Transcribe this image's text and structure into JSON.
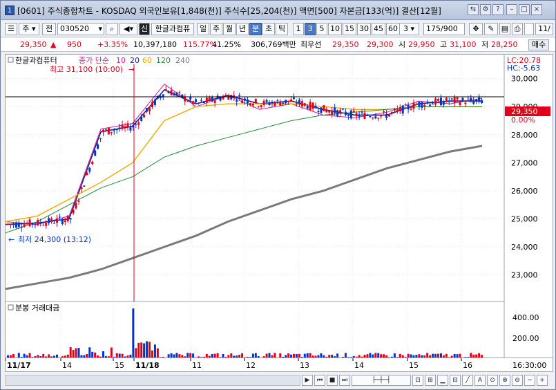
{
  "window": {
    "app_icon": "1",
    "title": "[0601] 주식종합차트 - KOSDAQ 외국인보유[1,848(천)] 주식수[25,204(천)] 액면[500] 자본금[133(억)] 결산[12월]"
  },
  "toolbar": {
    "type_select": "주",
    "prev_label": "전",
    "code": "030520",
    "stock_name": "한글과컴퓨",
    "new_badge": "신",
    "periods": [
      "일",
      "주",
      "월",
      "년",
      "분",
      "초",
      "틱"
    ],
    "selected_period": "분",
    "intervals": [
      "1",
      "3",
      "5",
      "10",
      "15",
      "30",
      "45",
      "60"
    ],
    "selected_interval": "3",
    "count_select": "3",
    "bar_count": "175",
    "bar_total": "/900",
    "ratio_label": "11/"
  },
  "quote": {
    "price": "29,350",
    "direction": "▲",
    "change": "950",
    "change_pct": "+3.35%",
    "volume": "10,397,180",
    "vol_ratio": "115.77%",
    "turnover": "41.25%",
    "amount": "306,769백만",
    "best_bid_label": "최우선",
    "best_bid": "29,350",
    "best_ask": "29,300",
    "open_label": "시",
    "open": "29,950",
    "high_label": "고",
    "high": "31,100",
    "low_label": "저",
    "low": "28,250",
    "order_button": "매수"
  },
  "price_panel": {
    "legend_name": "한글과컴퓨터",
    "legend_desc": "종가 단순",
    "ma_periods": [
      "10",
      "20",
      "60",
      "120",
      "240"
    ],
    "ma_colors": [
      "#d81b9a",
      "#1a237e",
      "#f2a900",
      "#1f8a3a",
      "#7a7a7a"
    ],
    "high_annotation": "최고 31,100 (10:00)",
    "low_annotation": "최저 24,300 (13:12)",
    "lc_label": "LC:20.78",
    "hc_label": "HC:-5.63",
    "current_price_tag": "29,350",
    "current_pct_tag": "0.00%",
    "y_ticks": [
      "30,000",
      "29,000",
      "28,000",
      "27,000",
      "26,000",
      "25,000",
      "24,000",
      "23,000"
    ]
  },
  "volume_panel": {
    "title": "분봉 거래대금",
    "y_ticks": [
      "400.00",
      "200.00"
    ]
  },
  "x_axis": {
    "labels": [
      "11/17",
      "14",
      "15",
      "11/18",
      "11",
      "12",
      "13",
      "14",
      "15",
      "16"
    ],
    "right_time": "16:30:00"
  },
  "colors": {
    "up": "#e0001a",
    "down": "#0033cc",
    "accent": "#4b78c4"
  },
  "chart_data": {
    "type": "candlestick",
    "x": [
      "11/17",
      "14",
      "15",
      "11/18",
      "11",
      "12",
      "13",
      "14",
      "15",
      "16"
    ],
    "ylim": [
      22300,
      31100
    ],
    "series": [
      {
        "name": "10",
        "values": [
          24900,
          24800,
          25100,
          28200,
          28400,
          29800,
          29000,
          29400,
          28900,
          29100,
          28700,
          28600,
          28800,
          29200,
          29100,
          29300
        ]
      },
      {
        "name": "20",
        "values": [
          24800,
          24850,
          25000,
          28100,
          28300,
          29600,
          29100,
          29400,
          29100,
          29200,
          28900,
          28700,
          28700,
          29100,
          29200,
          29200
        ]
      },
      {
        "name": "60",
        "values": [
          24900,
          25100,
          25700,
          26300,
          27000,
          28500,
          29000,
          29100,
          29100,
          29100,
          29000,
          28900,
          28900,
          29000,
          29000,
          29000
        ]
      },
      {
        "name": "120",
        "values": [
          24500,
          24900,
          25500,
          26100,
          26500,
          27200,
          27600,
          27900,
          28200,
          28500,
          28700,
          28800,
          28900,
          29000,
          29000,
          29000
        ]
      },
      {
        "name": "240",
        "values": [
          22500,
          22700,
          22900,
          23200,
          23600,
          24000,
          24400,
          24900,
          25300,
          25700,
          26000,
          26400,
          26800,
          27100,
          27400,
          27600
        ]
      }
    ],
    "volume_ylim": [
      0,
      450
    ]
  }
}
